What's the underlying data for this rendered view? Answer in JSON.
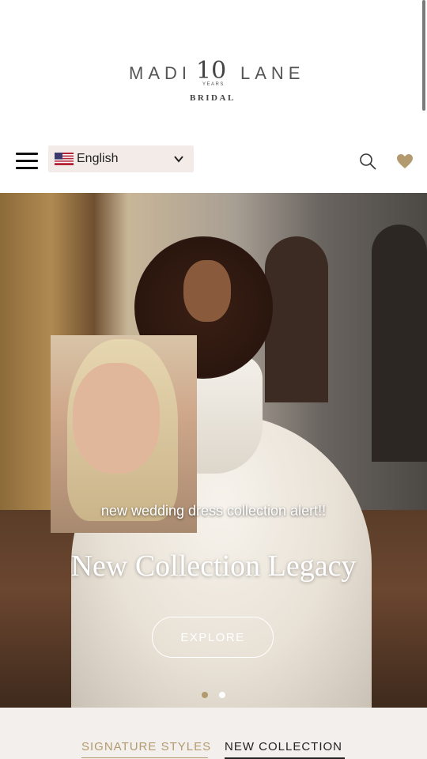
{
  "brand": {
    "left": "MADI",
    "ten": "10",
    "years": "YEARS",
    "right": "LANE",
    "sub": "BRIDAL"
  },
  "nav": {
    "language": "English"
  },
  "hero": {
    "caption": "new wedding dress collection alert!!",
    "title": "New Collection Legacy",
    "button": "EXPLORE",
    "slide_count": 2,
    "active_slide": 2
  },
  "tabs": [
    {
      "label": "SIGNATURE STYLES"
    },
    {
      "label": "NEW COLLECTION"
    }
  ],
  "colors": {
    "accent_gold": "#b39a6e",
    "lang_bg": "#f3ebe8",
    "heart": "#b39a6e"
  },
  "icons": [
    "menu-icon",
    "us-flag-icon",
    "chevron-down-icon",
    "search-icon",
    "heart-icon"
  ]
}
